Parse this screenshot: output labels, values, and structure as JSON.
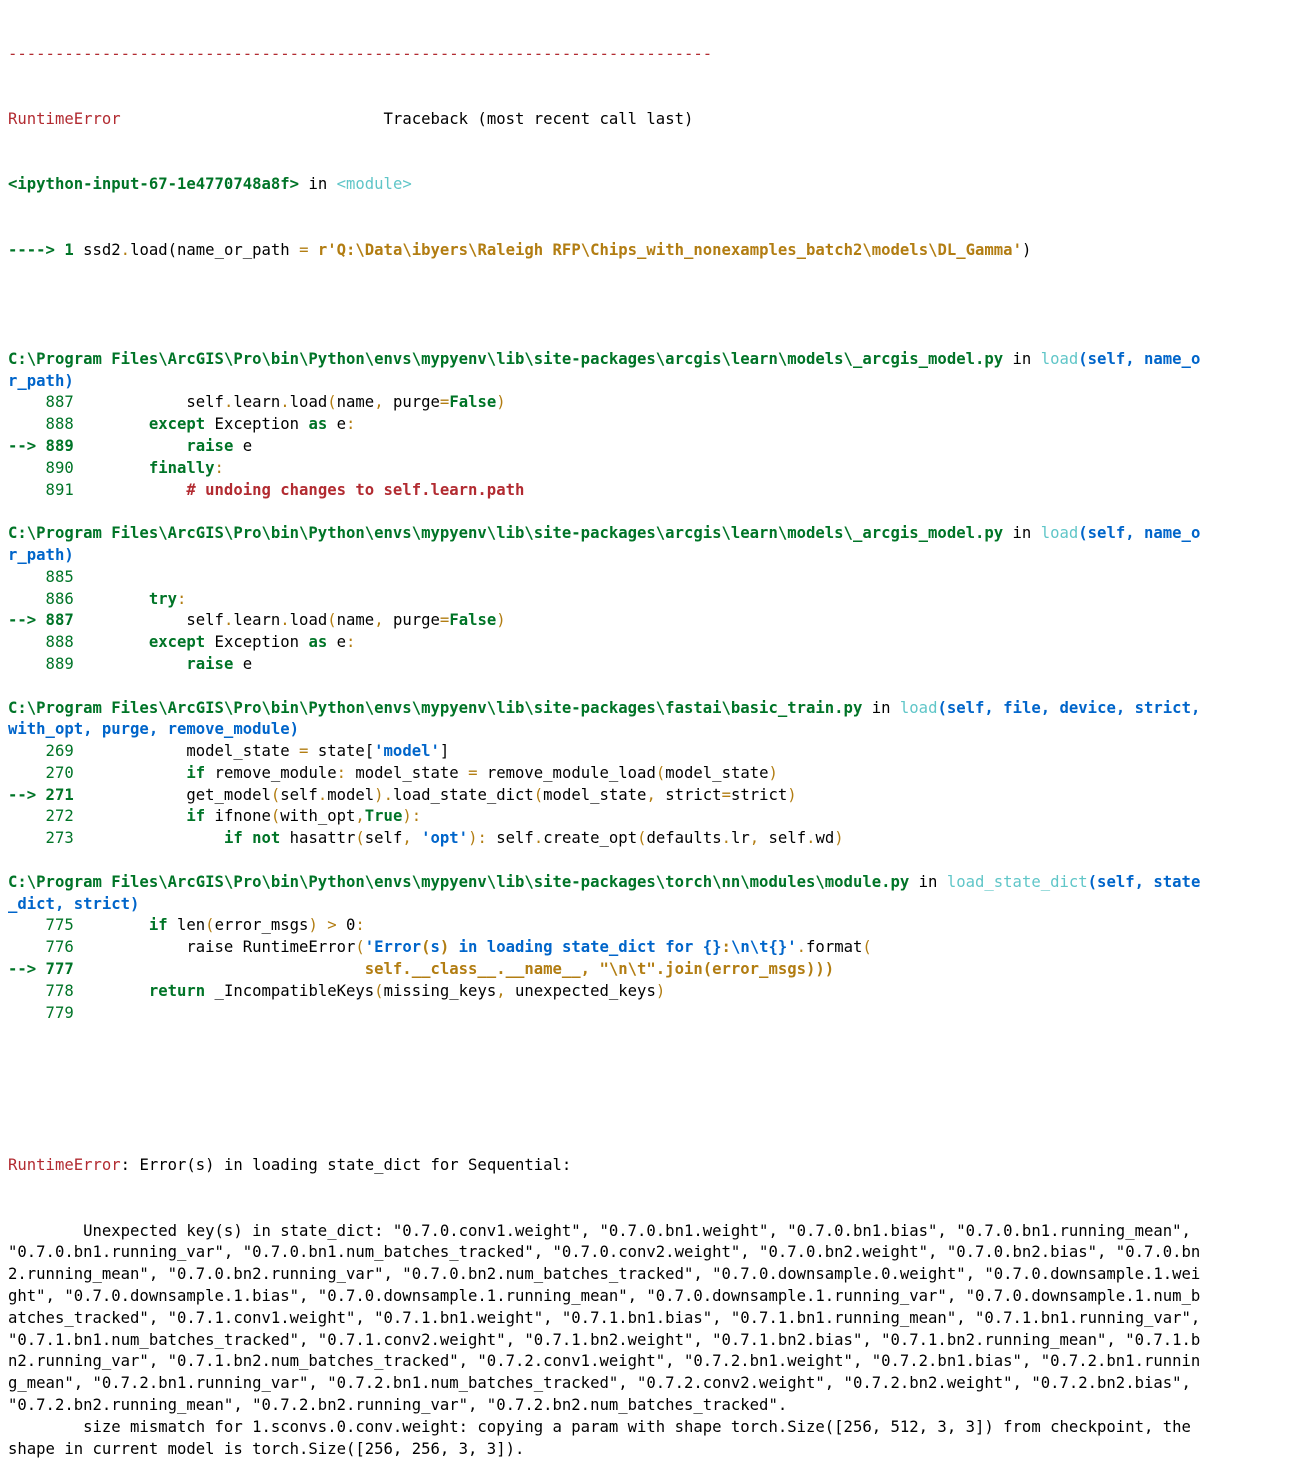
{
  "traceback": {
    "separator": "---------------------------------------------------------------------------",
    "error_name": "RuntimeError",
    "header": "Traceback (most recent call last)",
    "input_cell": "<ipython-input-67-1e4770748a8f>",
    "in_word": "in",
    "module_word": "<module>",
    "first_arrow": "----> 1",
    "first_code": {
      "obj": "ssd2",
      "dot": ".",
      "call": "load",
      "args": "(name_or_path ",
      "eq": "=",
      "raw": " r'Q:\\Data\\ibyers\\Raleigh RFP\\Chips_with_nonexamples_batch2\\models\\DL_Gamma'",
      "close": ")"
    },
    "frames": [
      {
        "path_line1": "C:\\Program Files\\ArcGIS\\Pro\\bin\\Python\\envs\\mypyenv\\lib\\site-packages\\arcgis\\learn\\models\\_arcgis_model.py",
        "in_word": " in ",
        "func": "load",
        "sig1": "(self, name_o",
        "sig2": "r_path)",
        "lines": [
          {
            "no": "    887",
            "code": "            self.learn.load(name, purge=False)"
          },
          {
            "no": "    888",
            "code": "        except Exception as e:"
          },
          {
            "no": "--> 889",
            "code": "            raise e"
          },
          {
            "no": "    890",
            "code": "        finally:"
          },
          {
            "no": "    891",
            "code": "            # undoing changes to self.learn.path"
          }
        ]
      },
      {
        "path_line1": "C:\\Program Files\\ArcGIS\\Pro\\bin\\Python\\envs\\mypyenv\\lib\\site-packages\\arcgis\\learn\\models\\_arcgis_model.py",
        "in_word": " in ",
        "func": "load",
        "sig1": "(self, name_o",
        "sig2": "r_path)",
        "lines": [
          {
            "no": "    885",
            "code": ""
          },
          {
            "no": "    886",
            "code": "        try:"
          },
          {
            "no": "--> 887",
            "code": "            self.learn.load(name, purge=False)"
          },
          {
            "no": "    888",
            "code": "        except Exception as e:"
          },
          {
            "no": "    889",
            "code": "            raise e"
          }
        ]
      },
      {
        "path_line1": "C:\\Program Files\\ArcGIS\\Pro\\bin\\Python\\envs\\mypyenv\\lib\\site-packages\\fastai\\basic_train.py",
        "in_word": " in ",
        "func": "load",
        "sig1": "(self, file, device, strict,",
        "sig2": "with_opt, purge, remove_module)",
        "lines": [
          {
            "no": "    269",
            "code": "            model_state = state['model']"
          },
          {
            "no": "    270",
            "code": "            if remove_module: model_state = remove_module_load(model_state)"
          },
          {
            "no": "--> 271",
            "code": "            get_model(self.model).load_state_dict(model_state, strict=strict)"
          },
          {
            "no": "    272",
            "code": "            if ifnone(with_opt,True):"
          },
          {
            "no": "    273",
            "code": "                if not hasattr(self, 'opt'): self.create_opt(defaults.lr, self.wd)"
          }
        ]
      },
      {
        "path_line1": "C:\\Program Files\\ArcGIS\\Pro\\bin\\Python\\envs\\mypyenv\\lib\\site-packages\\torch\\nn\\modules\\module.py",
        "in_word": " in ",
        "func": "load_state_dict",
        "sig1": "(self, state",
        "sig2": "_dict, strict)",
        "lines": [
          {
            "no": "    775",
            "code": "        if len(error_msgs) > 0:"
          },
          {
            "no": "    776",
            "code": "            raise RuntimeError('Error(s) in loading state_dict for {}:\\n\\t{}'.format("
          },
          {
            "no": "--> 777",
            "code": "                               self.__class__.__name__, \"\\n\\t\".join(error_msgs)))"
          },
          {
            "no": "    778",
            "code": "        return _IncompatibleKeys(missing_keys, unexpected_keys)"
          },
          {
            "no": "    779",
            "code": ""
          }
        ]
      }
    ],
    "final_error": {
      "name": "RuntimeError",
      "message_lines": [
        ": Error(s) in loading state_dict for Sequential:",
        "\tUnexpected key(s) in state_dict: \"0.7.0.conv1.weight\", \"0.7.0.bn1.weight\", \"0.7.0.bn1.bias\", \"0.7.0.bn1.running_mean\",",
        "\"0.7.0.bn1.running_var\", \"0.7.0.bn1.num_batches_tracked\", \"0.7.0.conv2.weight\", \"0.7.0.bn2.weight\", \"0.7.0.bn2.bias\", \"0.7.0.bn",
        "2.running_mean\", \"0.7.0.bn2.running_var\", \"0.7.0.bn2.num_batches_tracked\", \"0.7.0.downsample.0.weight\", \"0.7.0.downsample.1.wei",
        "ght\", \"0.7.0.downsample.1.bias\", \"0.7.0.downsample.1.running_mean\", \"0.7.0.downsample.1.running_var\", \"0.7.0.downsample.1.num_b",
        "atches_tracked\", \"0.7.1.conv1.weight\", \"0.7.1.bn1.weight\", \"0.7.1.bn1.bias\", \"0.7.1.bn1.running_mean\", \"0.7.1.bn1.running_var\",",
        "\"0.7.1.bn1.num_batches_tracked\", \"0.7.1.conv2.weight\", \"0.7.1.bn2.weight\", \"0.7.1.bn2.bias\", \"0.7.1.bn2.running_mean\", \"0.7.1.b",
        "n2.running_var\", \"0.7.1.bn2.num_batches_tracked\", \"0.7.2.conv1.weight\", \"0.7.2.bn1.weight\", \"0.7.2.bn1.bias\", \"0.7.2.bn1.runnin",
        "g_mean\", \"0.7.2.bn1.running_var\", \"0.7.2.bn1.num_batches_tracked\", \"0.7.2.conv2.weight\", \"0.7.2.bn2.weight\", \"0.7.2.bn2.bias\",",
        "\"0.7.2.bn2.running_mean\", \"0.7.2.bn2.running_var\", \"0.7.2.bn2.num_batches_tracked\".",
        "\tsize mismatch for 1.sconvs.0.conv.weight: copying a param with shape torch.Size([256, 512, 3, 3]) from checkpoint, the",
        "shape in current model is torch.Size([256, 256, 3, 3])."
      ]
    },
    "colors": {
      "error_red": "#b22b31",
      "path_green": "#007427",
      "func_cyan": "#60c6c8",
      "sig_blue": "#0065ca",
      "string_gold": "#b27d12"
    }
  }
}
